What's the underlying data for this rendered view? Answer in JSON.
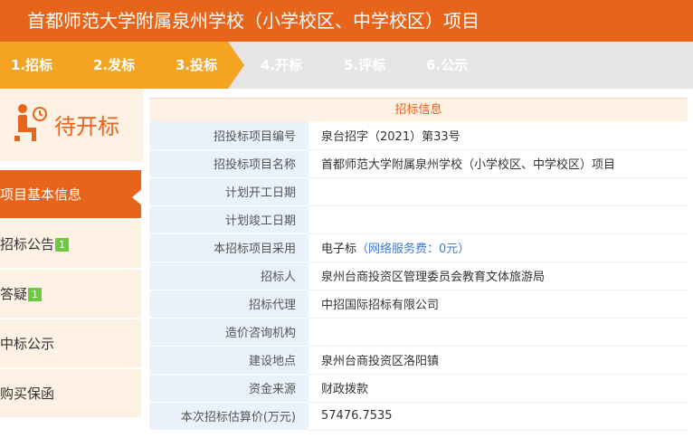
{
  "header": {
    "title": "首都师范大学附属泉州学校（小学校区、中学校区）项目"
  },
  "steps": [
    {
      "label": "1.招标"
    },
    {
      "label": "2.发标"
    },
    {
      "label": "3.投标"
    },
    {
      "label": "4.开标"
    },
    {
      "label": "5.评标"
    },
    {
      "label": "6.公示"
    }
  ],
  "status": {
    "text": "待开标"
  },
  "menu": [
    {
      "label": "项目基本信息",
      "badge": ""
    },
    {
      "label": "招标公告",
      "badge": "1"
    },
    {
      "label": "答疑",
      "badge": "1"
    },
    {
      "label": "中标公示",
      "badge": ""
    },
    {
      "label": "购买保函",
      "badge": ""
    }
  ],
  "panel": {
    "title": "招标信息",
    "rows": [
      {
        "key": "招投标项目编号",
        "value": "泉台招字（2021）第33号"
      },
      {
        "key": "招投标项目名称",
        "value": "首都师范大学附属泉州学校（小学校区、中学校区）项目"
      },
      {
        "key": "计划开工日期",
        "value": ""
      },
      {
        "key": "计划竣工日期",
        "value": ""
      },
      {
        "key": "本招标项目采用",
        "value": "电子标",
        "fee": "（网络服务费：0元）"
      },
      {
        "key": "招标人",
        "value": "泉州台商投资区管理委员会教育文体旅游局"
      },
      {
        "key": "招标代理",
        "value": "中招国际招标有限公司"
      },
      {
        "key": "造价咨询机构",
        "value": ""
      },
      {
        "key": "建设地点",
        "value": "泉州台商投资区洛阳镇"
      },
      {
        "key": "资金来源",
        "value": "财政拨款"
      },
      {
        "key": "本次招标估算价(万元)",
        "value": "57476.7535"
      }
    ]
  },
  "colors": {
    "accent": "#e8641b",
    "step_done": "#f4a422",
    "label_bg": "#e9f1fa",
    "badge": "#6dc93f"
  }
}
